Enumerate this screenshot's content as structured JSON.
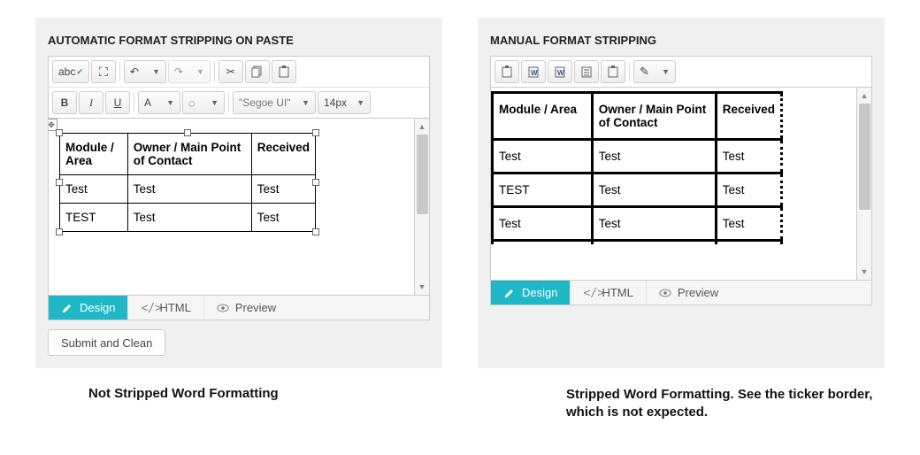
{
  "left": {
    "title": "AUTOMATIC FORMAT STRIPPING ON PASTE",
    "toolbar": {
      "spellcheck": "abc",
      "font_family": "\"Segoe UI\"",
      "font_size": "14px",
      "bold": "B",
      "italic": "I",
      "underline": "U",
      "fontA": "A"
    },
    "table": {
      "headers": [
        "Module / Area",
        "Owner / Main Point of Contact",
        "Received"
      ],
      "rows": [
        [
          "Test",
          "Test",
          "Test"
        ],
        [
          "TEST",
          "Test",
          "Test"
        ]
      ]
    },
    "tabs": {
      "design": "Design",
      "html": "HTML",
      "preview": "Preview"
    },
    "button": "Submit and Clean",
    "caption": "Not Stripped Word Formatting"
  },
  "right": {
    "title": "MANUAL FORMAT STRIPPING",
    "table": {
      "headers": [
        "Module / Area",
        "Owner / Main Point of Contact",
        "Received"
      ],
      "rows": [
        [
          "Test",
          "Test",
          "Test"
        ],
        [
          "TEST",
          "Test",
          "Test"
        ],
        [
          "Test",
          "Test",
          "Test"
        ]
      ]
    },
    "tabs": {
      "design": "Design",
      "html": "HTML",
      "preview": "Preview"
    },
    "caption": "Stripped Word Formatting. See the ticker border, which is not expected."
  }
}
